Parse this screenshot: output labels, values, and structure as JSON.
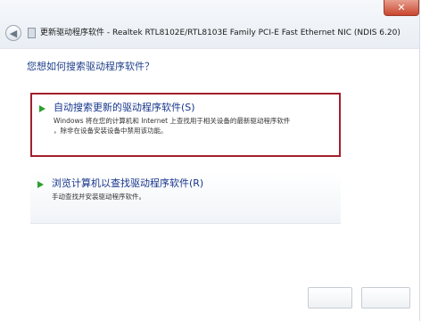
{
  "window": {
    "title": "更新驱动程序软件 - Realtek RTL8102E/RTL8103E Family PCI-E Fast Ethernet NIC (NDIS 6.20)",
    "close_label": "✕"
  },
  "heading": "您想如何搜索驱动程序软件？",
  "options": [
    {
      "title": "自动搜索更新的驱动程序软件(S)",
      "description_line1": "Windows 将在您的计算机和 Internet 上查找用于相关设备的最新驱动程序软件",
      "description_line2": "，除非在设备安装设备中禁用该功能。"
    },
    {
      "title": "浏览计算机以查找驱动程序软件(R)",
      "description_line1": "手动查找并安装驱动程序软件。"
    }
  ],
  "colors": {
    "heading": "#1e3f8a",
    "link": "#16358c",
    "highlight_border": "#a21f2c",
    "arrow": "#2f9e2f"
  }
}
